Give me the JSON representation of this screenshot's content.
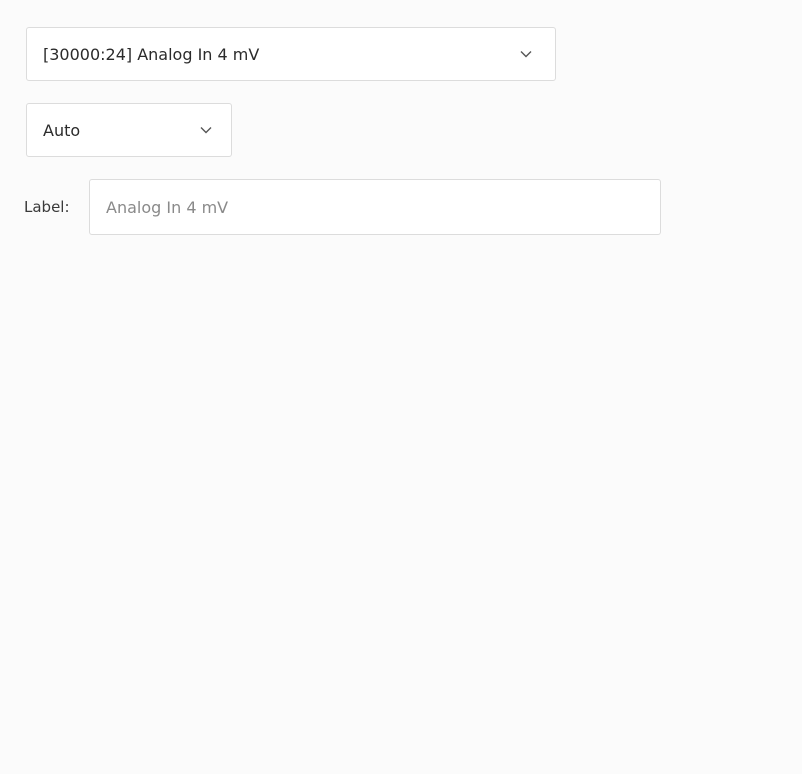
{
  "channel": {
    "selected": "[30000:24] Analog In 4 mV",
    "icon": "chevron-down-icon"
  },
  "mode": {
    "selected": "Auto",
    "icon": "chevron-down-icon"
  },
  "label": {
    "caption": "Label:",
    "placeholder": "Analog In 4 mV",
    "value": ""
  }
}
